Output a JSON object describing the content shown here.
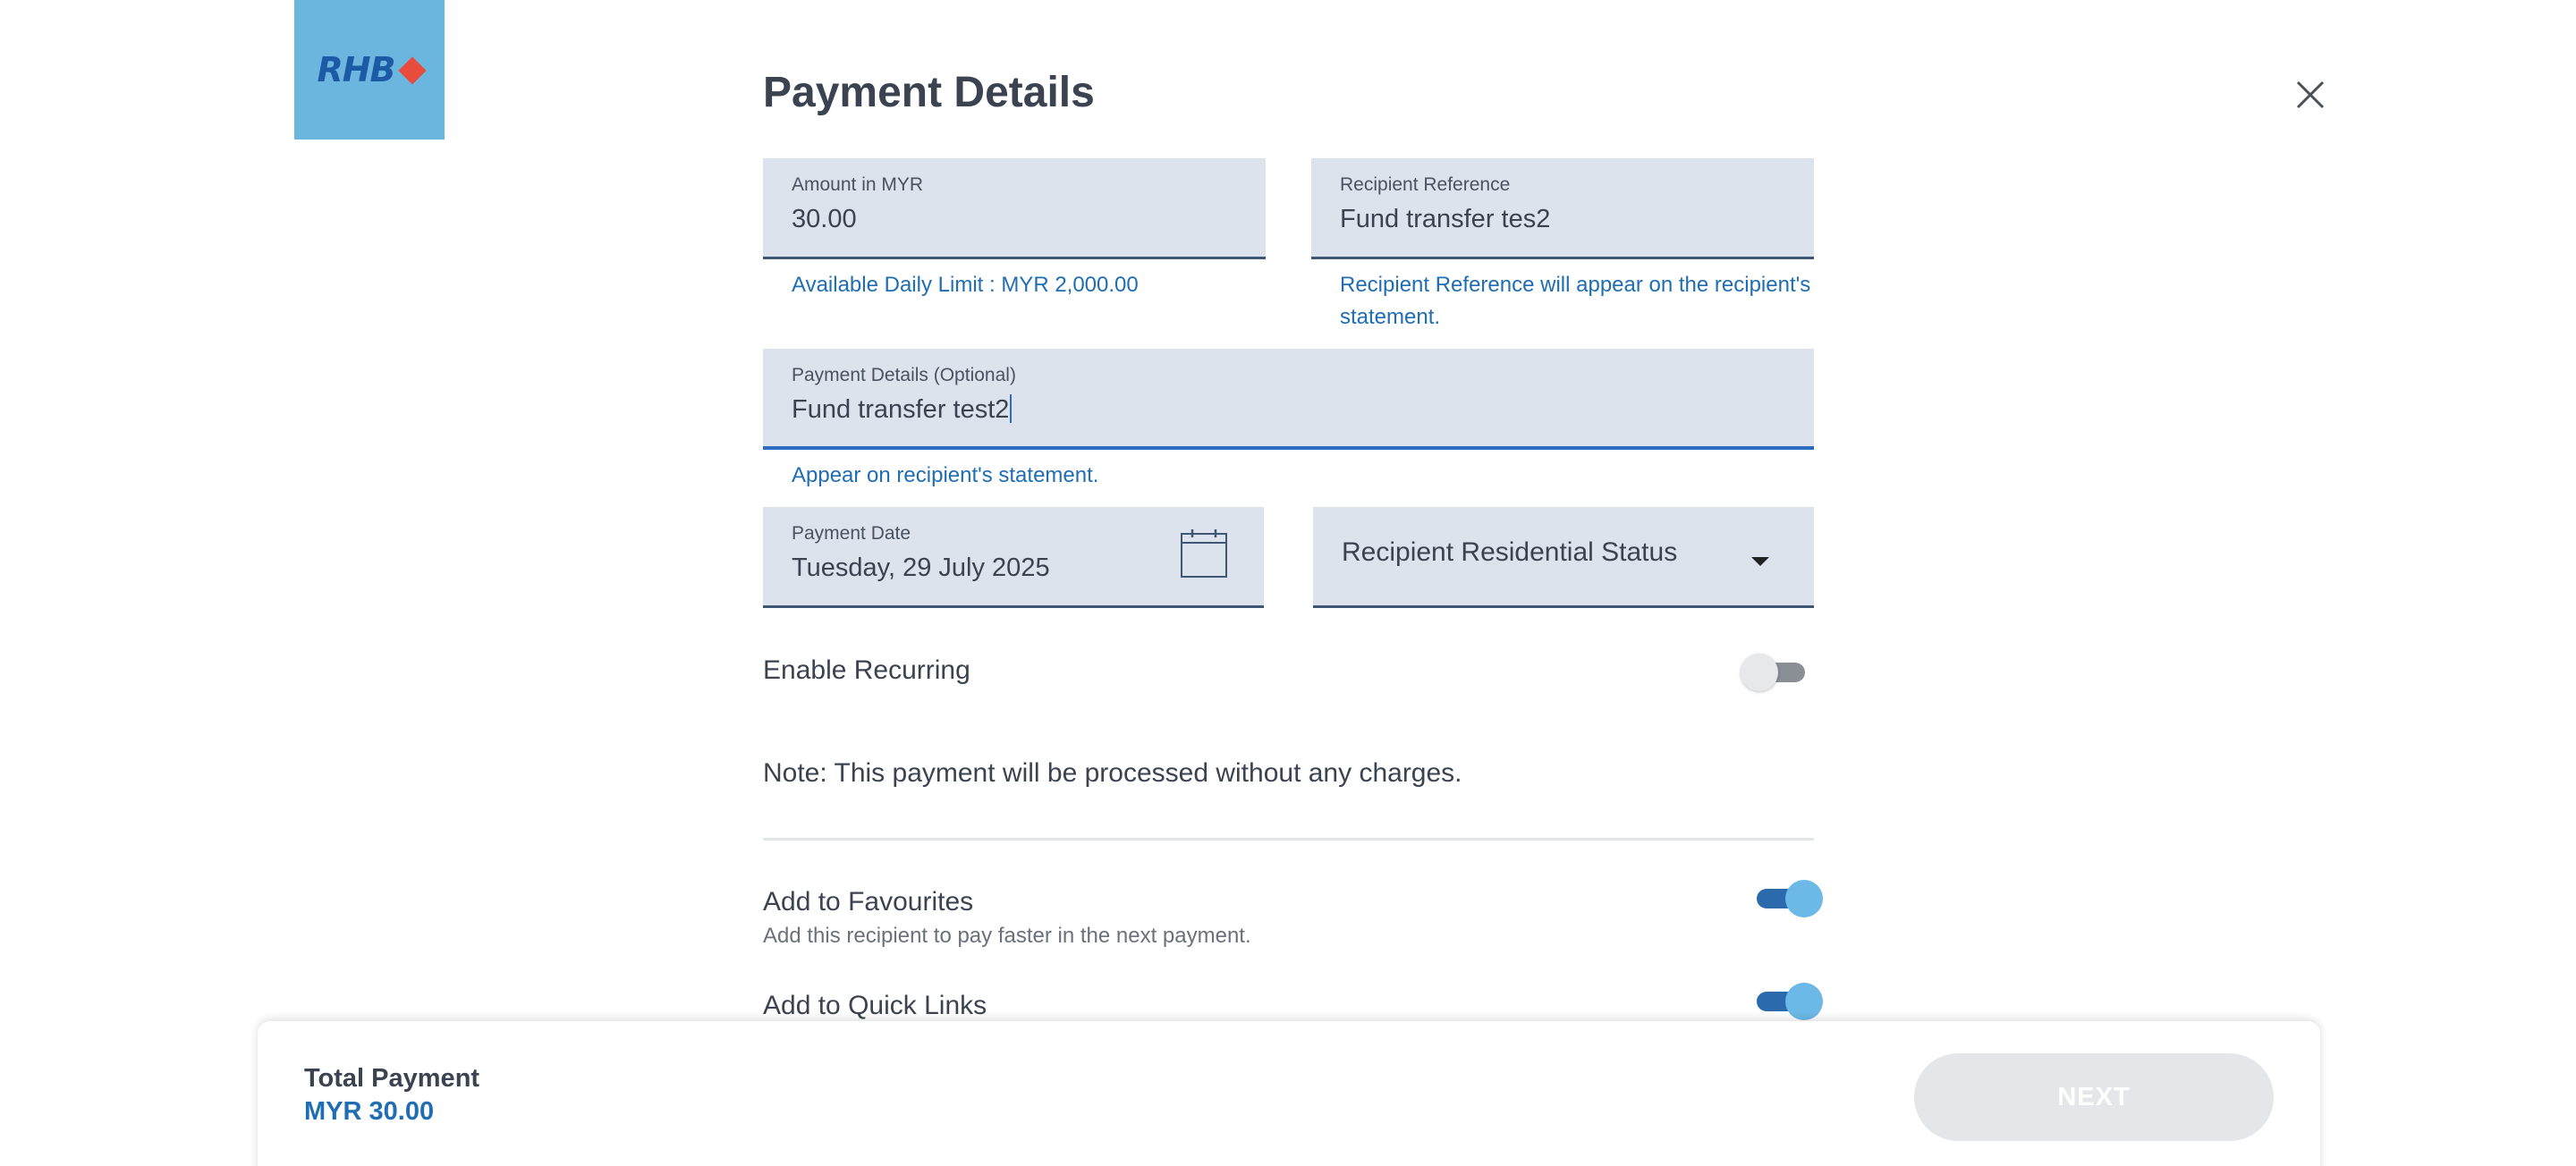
{
  "brand": {
    "logo_text": "RHB",
    "logo_bg": "#6bb6df",
    "logo_diamond_color": "#e94b3c"
  },
  "header": {
    "title": "Payment Details",
    "close_icon": "close-icon"
  },
  "form": {
    "amount": {
      "label": "Amount in MYR",
      "value": "30.00",
      "helper": "Available Daily Limit : MYR 2,000.00"
    },
    "recipient_reference": {
      "label": "Recipient Reference",
      "value": "Fund transfer tes2",
      "helper_line1": "Recipient Reference will appear on the recipient's",
      "helper_line2": "statement."
    },
    "payment_details": {
      "label": "Payment Details (Optional)",
      "value": "Fund transfer test2",
      "helper": "Appear on recipient's statement."
    },
    "payment_date": {
      "label": "Payment Date",
      "value": "Tuesday, 29 July 2025",
      "icon": "calendar-icon"
    },
    "residential_status": {
      "placeholder": "Recipient Residential Status",
      "icon": "chevron-down-icon"
    }
  },
  "recurring": {
    "label": "Enable Recurring",
    "enabled": false
  },
  "note": "Note: This payment will be processed without any charges.",
  "favourites": {
    "label": "Add to Favourites",
    "sublabel": "Add this recipient to pay faster in the next payment.",
    "enabled": true
  },
  "quick_links": {
    "label": "Add to Quick Links",
    "enabled": true
  },
  "footer": {
    "total_label": "Total Payment",
    "total_amount": "MYR 30.00",
    "next_label": "NEXT"
  },
  "colors": {
    "accent": "#1f6db3",
    "field_bg": "#dce3ed",
    "toggle_on": "#2a6aad",
    "button_disabled": "#e4e6e9"
  }
}
